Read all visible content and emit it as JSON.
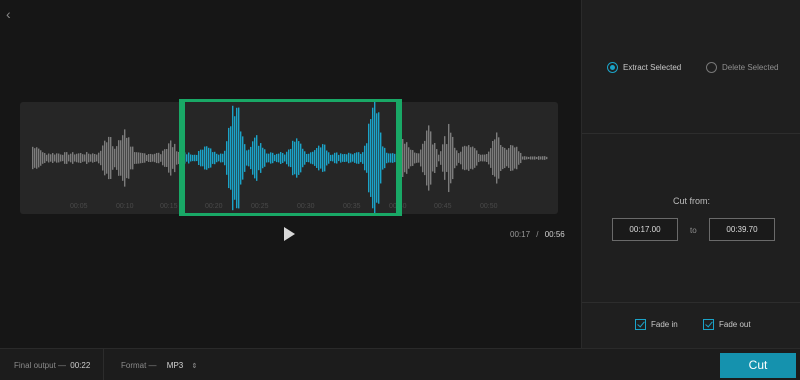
{
  "nav": {
    "back_icon": "chevron-left-icon",
    "back_glyph": "‹"
  },
  "waveform": {
    "ticks": [
      "00:05",
      "00:10",
      "00:15",
      "00:20",
      "00:25",
      "00:30",
      "00:35",
      "00:40",
      "00:45",
      "00:50"
    ],
    "colors": {
      "selected": "#1ba3c8",
      "unselected": "#7c7c7c",
      "handle": "#19a866",
      "track": "#262626"
    }
  },
  "player": {
    "current": "00:17",
    "separator": "/",
    "total": "00:56"
  },
  "mode": {
    "extract_label": "Extract Selected",
    "delete_label": "Delete Selected",
    "selected": "extract"
  },
  "cut_range": {
    "heading": "Cut from:",
    "start": "00:17.00",
    "to_label": "to",
    "end": "00:39.70"
  },
  "fades": {
    "fade_in_label": "Fade in",
    "fade_in": true,
    "fade_out_label": "Fade out",
    "fade_out": true
  },
  "footer": {
    "final_output_label": "Final output —",
    "final_output_value": "00:22",
    "format_label": "Format —",
    "format_value": "MP3",
    "format_arrow": "⇕",
    "cut_label": "Cut"
  },
  "accent_color": "#1592ae"
}
